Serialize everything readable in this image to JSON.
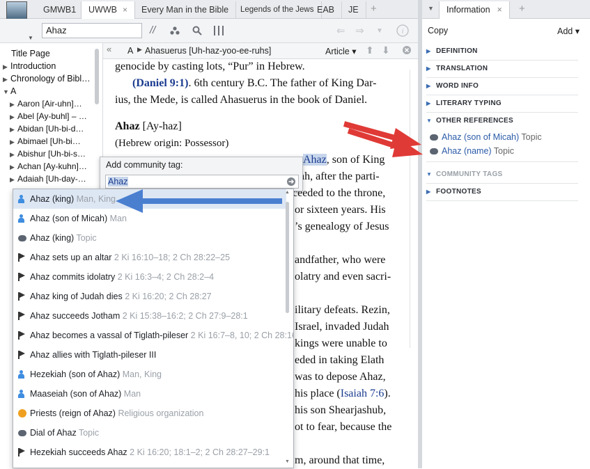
{
  "tabs": [
    {
      "label": "GMWB1"
    },
    {
      "label": "UWWB",
      "close": "×"
    },
    {
      "label": "Every Man in the Bible"
    },
    {
      "label": "Legends of the Jews"
    },
    {
      "label": "EAB"
    },
    {
      "label": "JE"
    }
  ],
  "plus": "+",
  "search": {
    "value": "Ahaz"
  },
  "toc": [
    {
      "label": "Title Page",
      "tri": ""
    },
    {
      "label": "Introduction",
      "tri": "▶"
    },
    {
      "label": "Chronology of Bibl…",
      "tri": "▶"
    },
    {
      "label": "A",
      "tri": "▼"
    },
    {
      "label": "Aaron [Air-uhn]…",
      "tri": "▶"
    },
    {
      "label": "Abel [Ay-buhl] – …",
      "tri": "▶"
    },
    {
      "label": "Abidan [Uh-bi-d…",
      "tri": "▶"
    },
    {
      "label": "Abimael [Uh-bi…",
      "tri": "▶"
    },
    {
      "label": "Abishur [Uh-bi-s…",
      "tri": "▶"
    },
    {
      "label": "Achan [Ay-kuhn]…",
      "tri": "▶"
    },
    {
      "label": "Adaiah [Uh-day-…",
      "tri": "▶"
    }
  ],
  "article": {
    "back": "«",
    "letter": "A",
    "title": "Ahasuerus [Uh-haz-yoo-ee-ruhs]",
    "mode": "Article ▾",
    "l1": "genocide by casting lots, “Pur” in Hebrew.",
    "ref_daniel": "(Daniel 9:1)",
    "l2b": ". 6th century B.C. The father of King Dar-",
    "l3": "ius, the Mede, is called Ahasuerus in the book of Daniel.",
    "head": "Ahaz",
    "head_pron": " [Ay-haz]",
    "origin": "(Hebrew origin: Possessor)",
    "r1a": "Ahaz",
    "r1b": ", son of King",
    "r2": "ah, after the parti-",
    "r3": "ceeded to the throne,",
    "r4": "or sixteen years. His",
    "r5": "’s genealogy of Jesus",
    "r6": "andfather, who were",
    "r7": "olatry and even sacri-",
    "r8": "ilitary defeats. Rezin,",
    "r9": "Israel, invaded Judah",
    "r10": "kings were unable to",
    "r11": "eded in taking Elath",
    "r12": "was to depose Ahaz,",
    "r13a": "his place (",
    "r13b": "Isaiah 7:6",
    "r13c": ").",
    "r14": "his son Shearjashub,",
    "r15": "ot to fear, because the",
    "r16": "m, around that time,"
  },
  "popup": {
    "title": "Add community tag:",
    "value": "Ahaz"
  },
  "suggestions": [
    {
      "label": "Ahaz (king)",
      "meta": " Man, King",
      "icon": "person"
    },
    {
      "label": "Ahaz (son of Micah)",
      "meta": " Man",
      "icon": "person"
    },
    {
      "label": "Ahaz (king)",
      "meta": " Topic",
      "icon": "bubble"
    },
    {
      "label": "Ahaz sets up an altar",
      "meta": " 2 Ki 16:10–18; 2 Ch 28:22–25",
      "icon": "flag"
    },
    {
      "label": "Ahaz commits idolatry",
      "meta": " 2 Ki 16:3–4; 2 Ch 28:2–4",
      "icon": "flag"
    },
    {
      "label": "Ahaz king of Judah dies",
      "meta": " 2 Ki 16:20; 2 Ch 28:27",
      "icon": "flag"
    },
    {
      "label": "Ahaz succeeds Jotham",
      "meta": " 2 Ki 15:38–16:2; 2 Ch 27:9–28:1",
      "icon": "flag"
    },
    {
      "label": "Ahaz becomes a vassal of Tiglath-pileser",
      "meta": " 2 Ki 16:7–8, 10; 2 Ch 28:16",
      "icon": "flag"
    },
    {
      "label": "Ahaz allies with Tiglath-pileser III",
      "meta": "",
      "icon": "flag"
    },
    {
      "label": "Hezekiah (son of Ahaz)",
      "meta": " Man, King",
      "icon": "person"
    },
    {
      "label": "Maaseiah (son of Ahaz)",
      "meta": " Man",
      "icon": "person"
    },
    {
      "label": "Priests (reign of Ahaz)",
      "meta": " Religious organization",
      "icon": "group"
    },
    {
      "label": "Dial of Ahaz",
      "meta": " Topic",
      "icon": "bubble"
    },
    {
      "label": "Hezekiah succeeds Ahaz",
      "meta": " 2 Ki 16:20; 18:1–2; 2 Ch 28:27–29:1",
      "icon": "flag"
    }
  ],
  "right": {
    "tab": "Information",
    "copy": "Copy",
    "add": "Add ▾",
    "sections": [
      {
        "label": "DEFINITION",
        "tri": "▶"
      },
      {
        "label": "TRANSLATION",
        "tri": "▶"
      },
      {
        "label": "WORD INFO",
        "tri": "▶"
      },
      {
        "label": "LITERARY TYPING",
        "tri": "▶"
      },
      {
        "label": "OTHER REFERENCES",
        "tri": "▼"
      },
      {
        "label": "COMMUNITY TAGS",
        "tri": "▼"
      },
      {
        "label": "FOOTNOTES",
        "tri": "▶"
      }
    ],
    "refs": [
      {
        "label": "Ahaz (son of Micah)",
        "kind": " Topic"
      },
      {
        "label": "Ahaz (name)",
        "kind": " Topic"
      }
    ]
  },
  "colors": {
    "accent": "#3f8de0",
    "annotation_red": "#e03a36",
    "annotation_blue": "#4a7fd0"
  }
}
